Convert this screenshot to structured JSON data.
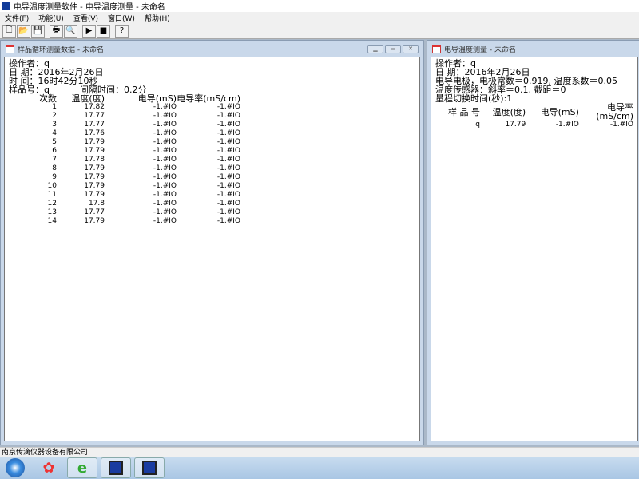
{
  "app": {
    "title": "电导温度测量软件 - 电导温度测量 - 未命名"
  },
  "menu": [
    "文件(F)",
    "功能(U)",
    "查看(V)",
    "窗口(W)",
    "帮助(H)"
  ],
  "toolbar": [
    {
      "icon": "new-file-icon",
      "g": "🗋"
    },
    {
      "icon": "open-folder-icon",
      "g": "📂"
    },
    {
      "icon": "save-icon",
      "g": "💾"
    },
    {
      "icon": "print-icon",
      "g": "🖶"
    },
    {
      "icon": "print-preview-icon",
      "g": "🔍"
    },
    {
      "icon": "play-icon",
      "g": "▶"
    },
    {
      "icon": "stop-icon",
      "g": "■"
    },
    {
      "icon": "help-icon",
      "g": "?"
    }
  ],
  "left": {
    "title": "样品循环测量数据 - 未命名",
    "operator": "操作者：q",
    "date": "日 期：2016年2月26日",
    "time": "时 间：16时42分10秒",
    "sample": "样品号：q",
    "interval": "间隔时间：0.2分",
    "headers": [
      "次数",
      "温度(度)",
      "电导(mS)",
      "电导率(mS/cm)"
    ],
    "rows": [
      [
        "1",
        "17.82",
        "-1.#IO",
        "-1.#IO"
      ],
      [
        "2",
        "17.77",
        "-1.#IO",
        "-1.#IO"
      ],
      [
        "3",
        "17.77",
        "-1.#IO",
        "-1.#IO"
      ],
      [
        "4",
        "17.76",
        "-1.#IO",
        "-1.#IO"
      ],
      [
        "5",
        "17.79",
        "-1.#IO",
        "-1.#IO"
      ],
      [
        "6",
        "17.79",
        "-1.#IO",
        "-1.#IO"
      ],
      [
        "7",
        "17.78",
        "-1.#IO",
        "-1.#IO"
      ],
      [
        "8",
        "17.79",
        "-1.#IO",
        "-1.#IO"
      ],
      [
        "9",
        "17.79",
        "-1.#IO",
        "-1.#IO"
      ],
      [
        "10",
        "17.79",
        "-1.#IO",
        "-1.#IO"
      ],
      [
        "11",
        "17.79",
        "-1.#IO",
        "-1.#IO"
      ],
      [
        "12",
        "17.8",
        "-1.#IO",
        "-1.#IO"
      ],
      [
        "13",
        "17.77",
        "-1.#IO",
        "-1.#IO"
      ],
      [
        "14",
        "17.79",
        "-1.#IO",
        "-1.#IO"
      ]
    ]
  },
  "right": {
    "title": "电导温度测量 - 未命名",
    "lines": [
      "操作者：q",
      "日 期：2016年2月26日",
      "电导电极，电极常数＝0.919, 温度系数＝0.05",
      "温度传感器：斜率＝0.1, 截距＝0",
      "量程切换时间(秒):1"
    ],
    "headers": [
      "样 品 号",
      "温度(度)",
      "电导(mS)",
      "电导率(mS/cm)"
    ],
    "rows": [
      [
        "q",
        "17.79",
        "-1.#IO",
        "-1.#IO"
      ]
    ]
  },
  "status": "南京传滴仪器设备有限公司"
}
